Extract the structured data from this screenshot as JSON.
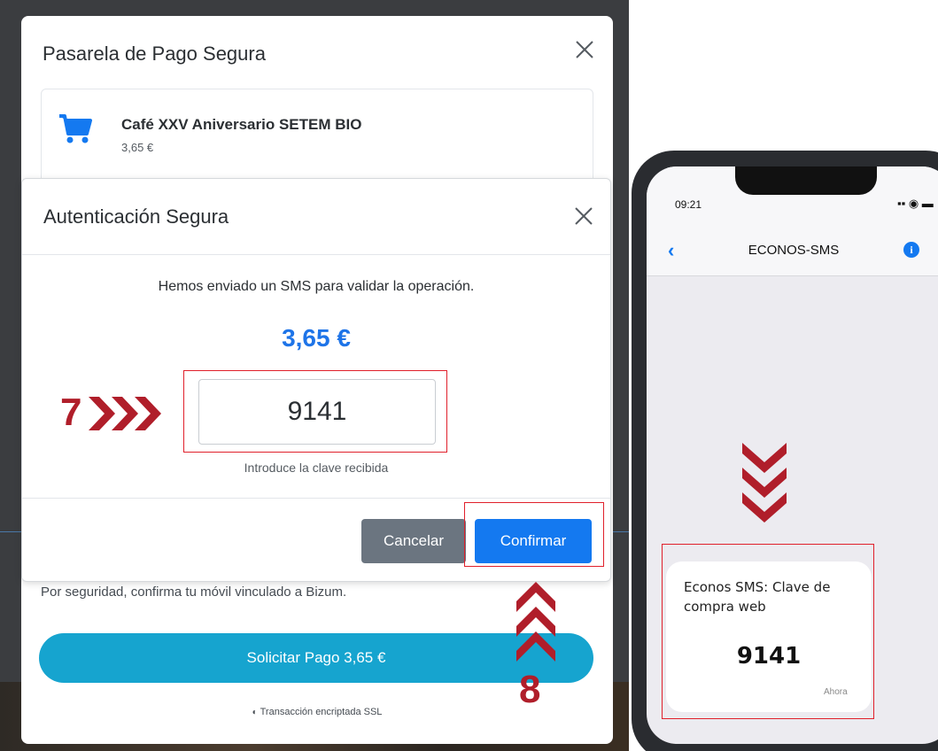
{
  "payment_modal": {
    "title": "Pasarela de Pago Segura",
    "product_name": "Café XXV Aniversario SETEM BIO",
    "product_price": "3,65 €",
    "bizum_note": "Por seguridad, confirma tu móvil vinculado a Bizum.",
    "request_button_label": "Solicitar Pago 3,65 €",
    "ssl_note": "Transacción encriptada SSL"
  },
  "auth_modal": {
    "title": "Autenticación Segura",
    "message": "Hemos enviado un SMS para validar la operación.",
    "amount": "3,65 €",
    "code_value": "9141",
    "code_hint": "Introduce la clave recibida",
    "cancel_label": "Cancelar",
    "confirm_label": "Confirmar"
  },
  "annotations": {
    "step_a": "7",
    "step_b": "8"
  },
  "phone": {
    "time": "09:21",
    "contact": "ECONOS-SMS",
    "sms_text": "Econos SMS: Clave de compra web",
    "sms_code": "9141",
    "sms_time": "Ahora"
  },
  "colors": {
    "accent_blue": "#1479f0",
    "amount_blue": "#1e74e8",
    "request_button": "#16a4cf",
    "cancel_button": "#6b7580",
    "annotation_red": "#b01e2a"
  },
  "icons": {
    "modal_close": "close-icon",
    "cart": "shopping-cart-icon",
    "ssl": "shield-icon",
    "back": "chevron-left-icon",
    "info": "info-icon"
  }
}
